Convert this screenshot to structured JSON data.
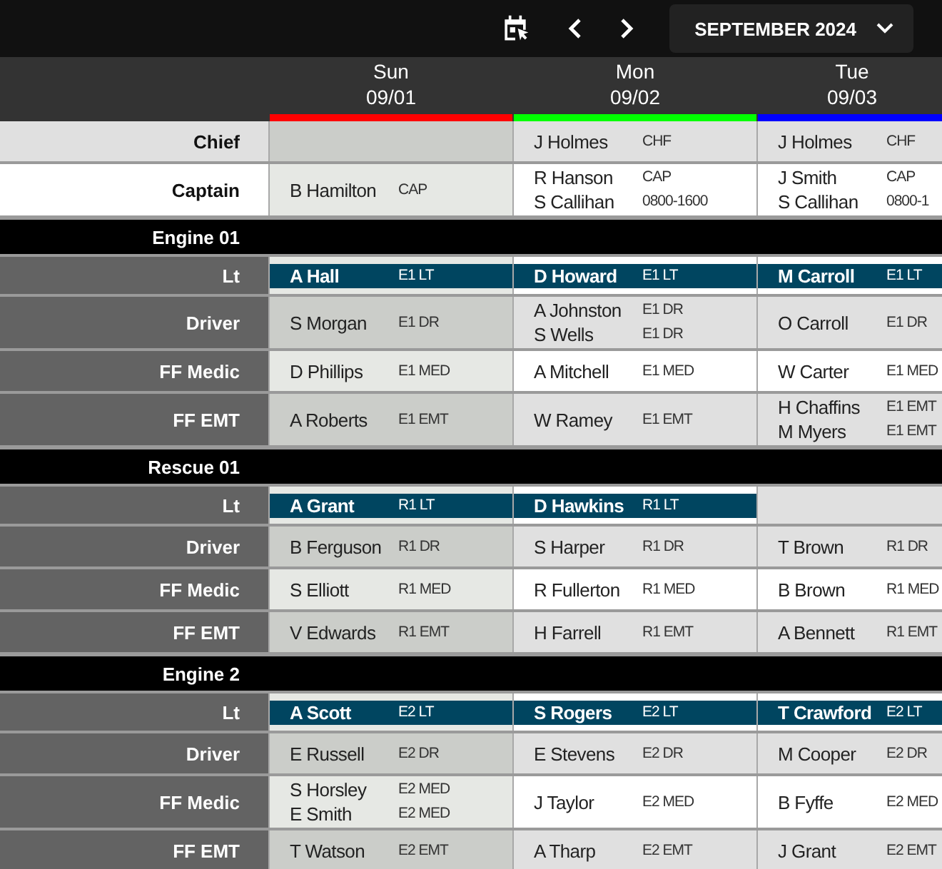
{
  "toolbar": {
    "month": "SEPTEMBER 2024"
  },
  "days": [
    {
      "name": "Sun",
      "date": "09/01",
      "color": "#ff0000",
      "weekend": true
    },
    {
      "name": "Mon",
      "date": "09/02",
      "color": "#00ff00",
      "weekend": false
    },
    {
      "name": "Tue",
      "date": "09/03",
      "color": "#0000ff",
      "weekend": false
    }
  ],
  "sections": [
    {
      "rows": [
        {
          "label": "Chief",
          "kind": "command",
          "cells": [
            {},
            {
              "assignments": [
                {
                  "name": "J Holmes",
                  "code": "CHF"
                }
              ]
            },
            {
              "assignments": [
                {
                  "name": "J Holmes",
                  "code": "CHF"
                }
              ]
            }
          ]
        },
        {
          "label": "Captain",
          "kind": "command",
          "cells": [
            {
              "assignments": [
                {
                  "name": "B Hamilton",
                  "code": "CAP"
                }
              ]
            },
            {
              "assignments": [
                {
                  "name": "R Hanson",
                  "code": "CAP"
                },
                {
                  "name": "S Callihan",
                  "code": "0800-1600"
                }
              ]
            },
            {
              "assignments": [
                {
                  "name": "J Smith",
                  "code": "CAP"
                },
                {
                  "name": "S Callihan",
                  "code": "0800-1"
                }
              ]
            }
          ]
        }
      ]
    },
    {
      "title": "Engine 01",
      "rows": [
        {
          "label": "Lt",
          "kind": "lead",
          "cells": [
            {
              "assignments": [
                {
                  "name": "A Hall",
                  "code": "E1 LT"
                }
              ]
            },
            {
              "assignments": [
                {
                  "name": "D Howard",
                  "code": "E1 LT"
                }
              ]
            },
            {
              "assignments": [
                {
                  "name": "M Carroll",
                  "code": "E1 LT"
                }
              ]
            }
          ]
        },
        {
          "label": "Driver",
          "kind": "crew",
          "cells": [
            {
              "assignments": [
                {
                  "name": "S Morgan",
                  "code": "E1 DR"
                }
              ]
            },
            {
              "assignments": [
                {
                  "name": "A Johnston",
                  "code": "E1 DR"
                },
                {
                  "name": "S Wells",
                  "code": "E1 DR"
                }
              ]
            },
            {
              "assignments": [
                {
                  "name": "O Carroll",
                  "code": "E1 DR"
                }
              ]
            }
          ]
        },
        {
          "label": "FF Medic",
          "kind": "crew",
          "cells": [
            {
              "assignments": [
                {
                  "name": "D Phillips",
                  "code": "E1 MED"
                }
              ]
            },
            {
              "assignments": [
                {
                  "name": "A Mitchell",
                  "code": "E1 MED"
                }
              ]
            },
            {
              "assignments": [
                {
                  "name": "W Carter",
                  "code": "E1 MED"
                }
              ]
            }
          ]
        },
        {
          "label": "FF EMT",
          "kind": "crew",
          "cells": [
            {
              "assignments": [
                {
                  "name": "A Roberts",
                  "code": "E1 EMT"
                }
              ]
            },
            {
              "assignments": [
                {
                  "name": "W Ramey",
                  "code": "E1 EMT"
                }
              ]
            },
            {
              "assignments": [
                {
                  "name": "H Chaffins",
                  "code": "E1 EMT"
                },
                {
                  "name": "M Myers",
                  "code": "E1 EMT"
                }
              ]
            }
          ]
        }
      ]
    },
    {
      "title": "Rescue 01",
      "rows": [
        {
          "label": "Lt",
          "kind": "lead",
          "cells": [
            {
              "assignments": [
                {
                  "name": "A Grant",
                  "code": "R1 LT"
                }
              ]
            },
            {
              "assignments": [
                {
                  "name": "D Hawkins",
                  "code": "R1 LT"
                }
              ]
            },
            {}
          ]
        },
        {
          "label": "Driver",
          "kind": "crew",
          "cells": [
            {
              "assignments": [
                {
                  "name": "B Ferguson",
                  "code": "R1 DR"
                }
              ]
            },
            {
              "assignments": [
                {
                  "name": "S Harper",
                  "code": "R1 DR"
                }
              ]
            },
            {
              "assignments": [
                {
                  "name": "T Brown",
                  "code": "R1 DR"
                }
              ]
            }
          ]
        },
        {
          "label": "FF Medic",
          "kind": "crew",
          "cells": [
            {
              "assignments": [
                {
                  "name": "S Elliott",
                  "code": "R1 MED"
                }
              ]
            },
            {
              "assignments": [
                {
                  "name": "R Fullerton",
                  "code": "R1 MED"
                }
              ]
            },
            {
              "assignments": [
                {
                  "name": "B Brown",
                  "code": "R1 MED"
                }
              ]
            }
          ]
        },
        {
          "label": "FF EMT",
          "kind": "crew",
          "cells": [
            {
              "assignments": [
                {
                  "name": "V Edwards",
                  "code": "R1 EMT"
                }
              ]
            },
            {
              "assignments": [
                {
                  "name": "H Farrell",
                  "code": "R1 EMT"
                }
              ]
            },
            {
              "assignments": [
                {
                  "name": "A Bennett",
                  "code": "R1 EMT"
                }
              ]
            }
          ]
        }
      ]
    },
    {
      "title": "Engine 2",
      "rows": [
        {
          "label": "Lt",
          "kind": "lead",
          "cells": [
            {
              "assignments": [
                {
                  "name": "A Scott",
                  "code": "E2 LT"
                }
              ]
            },
            {
              "assignments": [
                {
                  "name": "S Rogers",
                  "code": "E2 LT"
                }
              ]
            },
            {
              "assignments": [
                {
                  "name": "T Crawford",
                  "code": "E2 LT"
                }
              ]
            }
          ]
        },
        {
          "label": "Driver",
          "kind": "crew",
          "cells": [
            {
              "assignments": [
                {
                  "name": "E Russell",
                  "code": "E2 DR"
                }
              ]
            },
            {
              "assignments": [
                {
                  "name": "E Stevens",
                  "code": "E2 DR"
                }
              ]
            },
            {
              "assignments": [
                {
                  "name": "M Cooper",
                  "code": "E2 DR"
                }
              ]
            }
          ]
        },
        {
          "label": "FF Medic",
          "kind": "crew",
          "cells": [
            {
              "assignments": [
                {
                  "name": "S Horsley",
                  "code": "E2 MED"
                },
                {
                  "name": "E Smith",
                  "code": "E2 MED"
                }
              ]
            },
            {
              "assignments": [
                {
                  "name": "J Taylor",
                  "code": "E2 MED"
                }
              ]
            },
            {
              "assignments": [
                {
                  "name": "B Fyffe",
                  "code": "E2 MED"
                }
              ]
            }
          ]
        },
        {
          "label": "FF EMT",
          "kind": "crew",
          "cells": [
            {
              "assignments": [
                {
                  "name": "T Watson",
                  "code": "E2 EMT"
                }
              ]
            },
            {
              "assignments": [
                {
                  "name": "A Tharp",
                  "code": "E2 EMT"
                }
              ]
            },
            {
              "assignments": [
                {
                  "name": "J Grant",
                  "code": "E2 EMT"
                }
              ]
            }
          ]
        }
      ]
    }
  ]
}
